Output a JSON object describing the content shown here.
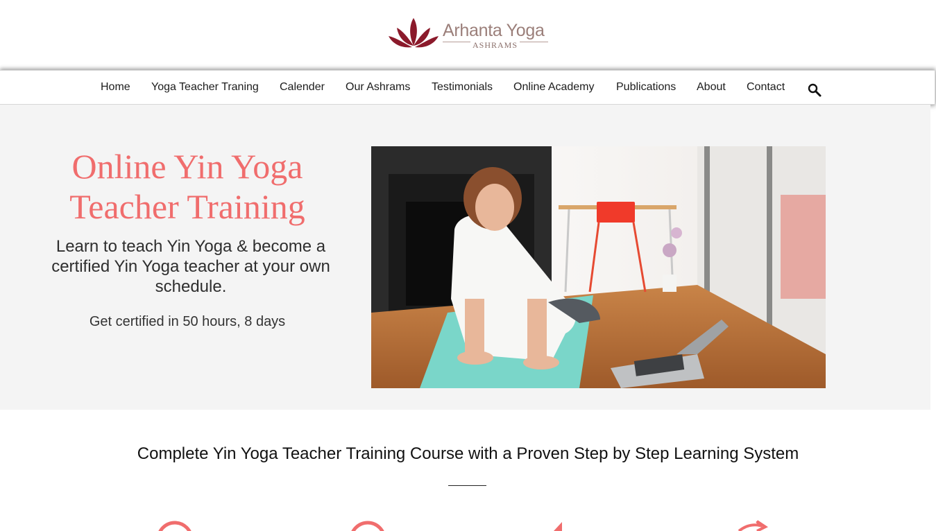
{
  "brand": {
    "name": "Arhanta Yoga",
    "subtitle": "ASHRAMS",
    "accent_color": "#8b1a2b"
  },
  "nav": {
    "items": [
      {
        "label": "Home"
      },
      {
        "label": "Yoga Teacher Traning"
      },
      {
        "label": "Calender"
      },
      {
        "label": "Our Ashrams"
      },
      {
        "label": "Testimonials"
      },
      {
        "label": "Online Academy"
      },
      {
        "label": "Publications"
      },
      {
        "label": "About"
      },
      {
        "label": "Contact"
      }
    ],
    "search_icon": "search-icon"
  },
  "hero": {
    "title": "Online Yin Yoga Teacher Training",
    "subtitle": "Learn to teach Yin Yoga & become a certified Yin Yoga teacher at your own schedule.",
    "certification": "Get certified in 50 hours, 8 days",
    "title_color": "#f06d6d",
    "background_color": "#f4f4f4"
  },
  "section": {
    "title": "Complete Yin Yoga Teacher Training Course with a Proven Step by Step Learning System",
    "icon_color": "#f06d6d"
  }
}
